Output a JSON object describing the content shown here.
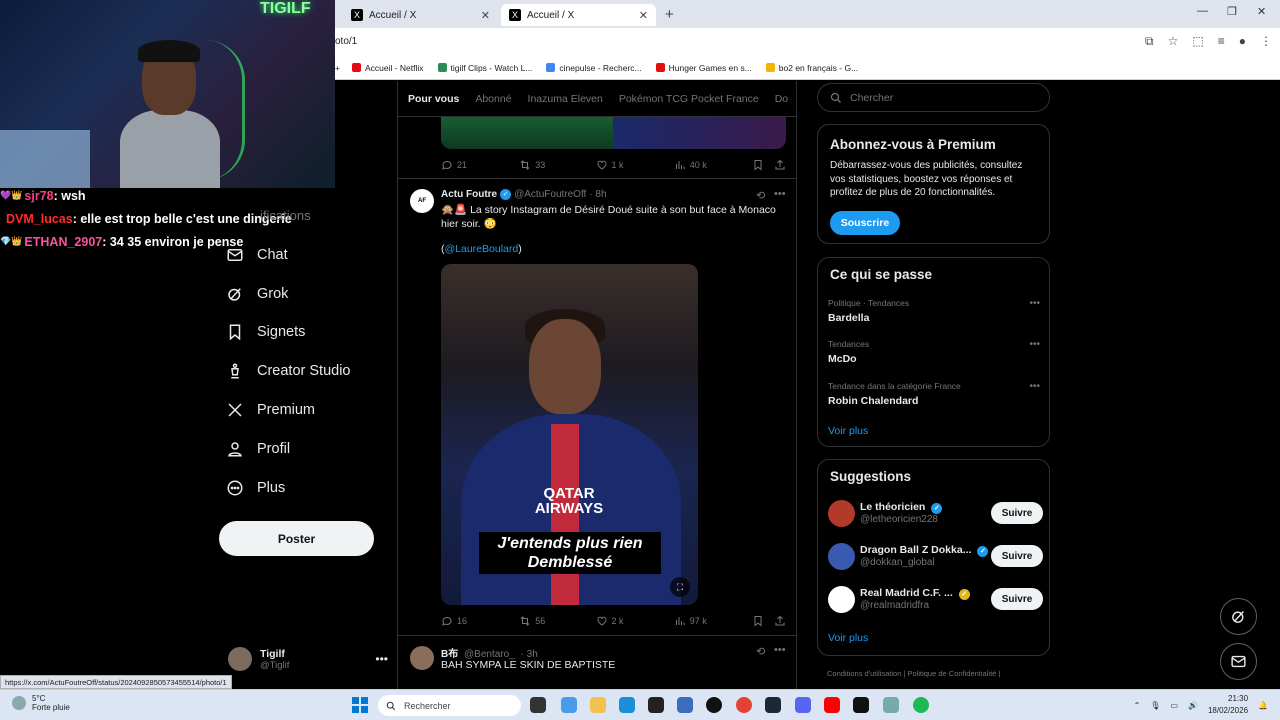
{
  "browser": {
    "tabs": [
      {
        "title": "Accueil / X",
        "active": false
      },
      {
        "title": "Accueil / X",
        "active": true
      }
    ],
    "address": "oto/1",
    "bookmarks": [
      {
        "label": "Accueil - Netflix",
        "color": "#e50914"
      },
      {
        "label": "tigilf Clips - Watch L...",
        "color": "#2e8b57"
      },
      {
        "label": "cinepulse - Recherc...",
        "color": "#4285f4"
      },
      {
        "label": "Hunger Games en s...",
        "color": "#d11"
      },
      {
        "label": "bo2 en français - G...",
        "color": "#f4b400"
      }
    ],
    "status_url": "https://x.com/ActuFoutreOff/status/2024092850573455514/photo/1"
  },
  "webcam": {
    "neon_text": "TIGILF"
  },
  "chat": [
    {
      "user": "sjr78",
      "color": "#ff3b8a",
      "message": " : wsh"
    },
    {
      "user": "DVM_lucas",
      "color": "#ff2b2b",
      "message": " : elle est trop belle c'est une dingerie"
    },
    {
      "user": "ETHAN_2907",
      "color": "#ff4fa3",
      "message": " : 34 35 environ je pense"
    }
  ],
  "nav": {
    "faded_label": "ifications",
    "items": [
      {
        "label": "Chat",
        "icon": "mail-icon"
      },
      {
        "label": "Grok",
        "icon": "grok-icon"
      },
      {
        "label": "Signets",
        "icon": "bookmark-icon"
      },
      {
        "label": "Creator Studio",
        "icon": "creator-icon"
      },
      {
        "label": "Premium",
        "icon": "x-icon"
      },
      {
        "label": "Profil",
        "icon": "person-icon"
      },
      {
        "label": "Plus",
        "icon": "more-icon"
      }
    ],
    "post_label": "Poster",
    "account": {
      "name": "Tigilf",
      "handle": "@Tiglif"
    }
  },
  "timeline": {
    "tabs": [
      "Pour vous",
      "Abonné",
      "Inazuma Eleven",
      "Pokémon TCG Pocket France",
      "Do"
    ],
    "prev_actions": {
      "replies": "21",
      "reposts": "33",
      "likes": "1 k",
      "views": "40 k"
    },
    "tweet": {
      "avatar_text": "AF",
      "name": "Actu Foutre",
      "handle": "@ActuFoutreOff",
      "time": "· 8h",
      "text": "🙊🚨 La story Instagram de Désiré Doué suite à son but face à Monaco hier soir. 😳",
      "link_prefix": "(",
      "link": "@LaureBoulard",
      "link_suffix": ")",
      "media": {
        "jersey": "QATAR AIRWAYS",
        "caption": "J'entends plus rien Demblessé"
      },
      "actions": {
        "replies": "16",
        "reposts": "56",
        "likes": "2 k",
        "views": "97 k"
      }
    },
    "tweet2": {
      "name": "B布",
      "handle": "@Bentaro_",
      "time": "· 3h",
      "text": "BAH SYMPA LE SKIN DE BAPTISTE"
    }
  },
  "right": {
    "search_placeholder": "Chercher",
    "premium": {
      "title": "Abonnez-vous à Premium",
      "text": "Débarrassez-vous des publicités, consultez vos statistiques, boostez vos réponses et profitez de plus de 20 fonctionnalités.",
      "button": "Souscrire"
    },
    "trends": {
      "title": "Ce qui se passe",
      "items": [
        {
          "category": "Politique · Tendances",
          "name": "Bardella"
        },
        {
          "category": "Tendances",
          "name": "McDo"
        },
        {
          "category": "Tendance dans la catégorie France",
          "name": "Robin Chalendard"
        }
      ],
      "see_more": "Voir plus"
    },
    "suggestions": {
      "title": "Suggestions",
      "items": [
        {
          "name": "Le théoricien",
          "handle": "@letheoricien228",
          "button": "Suivre",
          "color": "#b23a2a"
        },
        {
          "name": "Dragon Ball Z Dokka...",
          "handle": "@dokkan_global",
          "button": "Suivre",
          "color": "#3a5ab2"
        },
        {
          "name": "Real Madrid C.F. ...",
          "handle": "@realmadridfra",
          "button": "Suivre",
          "color": "#ffffff"
        }
      ],
      "see_more": "Voir plus"
    },
    "footer": "Conditions d'utilisation  |  Politique de Confidentialité  |"
  },
  "taskbar": {
    "weather_temp": "5°C",
    "weather_desc": "Forte pluie",
    "search_placeholder": "Rechercher",
    "time": "21:30",
    "date": "18/02/2026"
  }
}
